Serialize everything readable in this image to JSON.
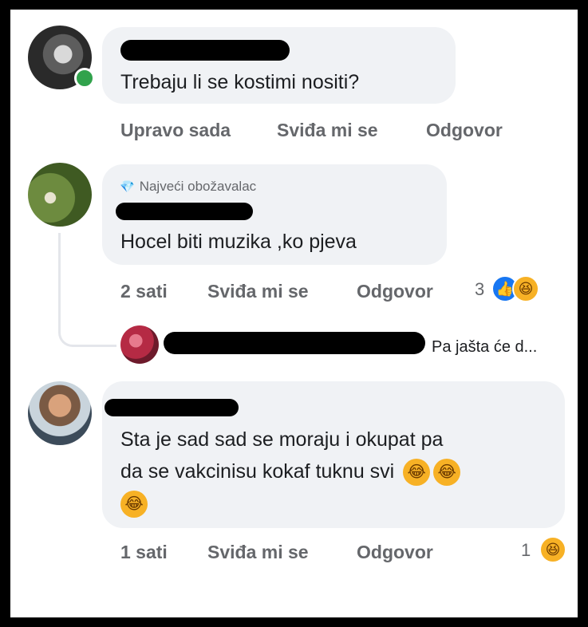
{
  "comments": [
    {
      "text": "Trebaju li se kostimi nositi?",
      "time": "Upravo sada",
      "like_label": "Sviđa mi se",
      "reply_label": "Odgovor"
    },
    {
      "badge": "Najveći obožavalac",
      "text": "Hocel biti muzika ,ko pjeva",
      "time": "2 sati",
      "like_label": "Sviđa mi se",
      "reply_label": "Odgovor",
      "reaction_count": "3",
      "reactions": [
        "like",
        "haha"
      ]
    },
    {
      "reply_preview": "Pa jašta će d..."
    },
    {
      "text_line1": "Sta je sad sad se moraju i okupat pa",
      "text_line2": "da se vakcinisu kokaf tuknu svi",
      "emoji": "😂",
      "time": "1 sati",
      "like_label": "Sviđa mi se",
      "reply_label": "Odgovor",
      "reaction_count": "1",
      "reactions": [
        "haha"
      ]
    }
  ],
  "icons": {
    "badge_icon": "💎",
    "like_icon": "👍",
    "haha_icon": "😆"
  }
}
